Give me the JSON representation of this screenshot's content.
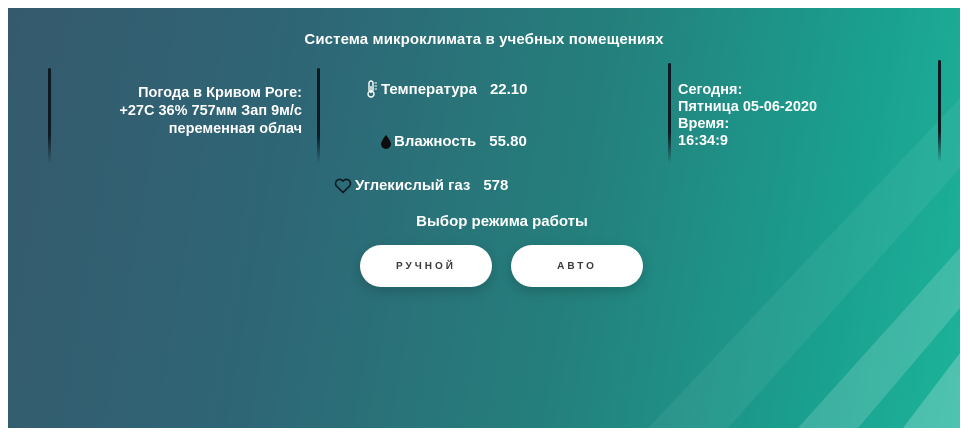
{
  "header": {
    "title": "Система микроклимата в учебных помещениях"
  },
  "weather": {
    "line1": "Погода в Кривом Роге:",
    "line2": "+27С 36% 757мм Зап 9м/с",
    "line3": "переменная облач"
  },
  "sensors": {
    "temperature": {
      "label": "Температура",
      "value": "22.10",
      "icon": "thermometer-icon"
    },
    "humidity": {
      "label": "Влажность",
      "value": "55.80",
      "icon": "droplet-icon"
    },
    "co2": {
      "label": "Углекислый газ",
      "value": "578",
      "icon": "heart-icon"
    }
  },
  "datetime": {
    "today_label": "Сегодня:",
    "date": "Пятница 05-06-2020",
    "time_label": "Время:",
    "time": "16:34:9"
  },
  "mode": {
    "title": "Выбор режима работы",
    "manual_label": "РУЧНОЙ",
    "auto_label": "АВТО"
  },
  "colors": {
    "gradient_start": "#355a6d",
    "gradient_end": "#1db39a",
    "divider": "#0d1a22",
    "button_bg": "#ffffff"
  }
}
